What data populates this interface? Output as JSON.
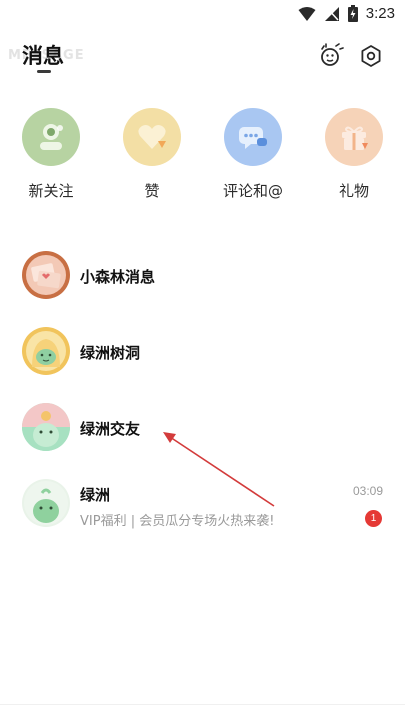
{
  "status": {
    "time": "3:23"
  },
  "header": {
    "title": "消息",
    "watermark": "MESSAGE"
  },
  "quick_actions": [
    {
      "label": "新关注",
      "color": "#b7d3a2",
      "icon": "new-follower-icon"
    },
    {
      "label": "赞",
      "color": "#f3dfa5",
      "icon": "heart-icon"
    },
    {
      "label": "评论和@",
      "color": "#a9c7f2",
      "icon": "comment-icon"
    },
    {
      "label": "礼物",
      "color": "#f6d3b8",
      "icon": "gift-icon"
    }
  ],
  "messages": [
    {
      "name": "小森林消息",
      "preview": "",
      "time": "",
      "badge": ""
    },
    {
      "name": "绿洲树洞",
      "preview": "",
      "time": "",
      "badge": ""
    },
    {
      "name": "绿洲交友",
      "preview": "",
      "time": "",
      "badge": ""
    },
    {
      "name": "绿洲",
      "preview": "VIP福利 | 会员瓜分专场火热来袭!",
      "time": "03:09",
      "badge": "1"
    }
  ],
  "colors": {
    "badge": "#e53935",
    "annotation": "#d33b3b"
  }
}
